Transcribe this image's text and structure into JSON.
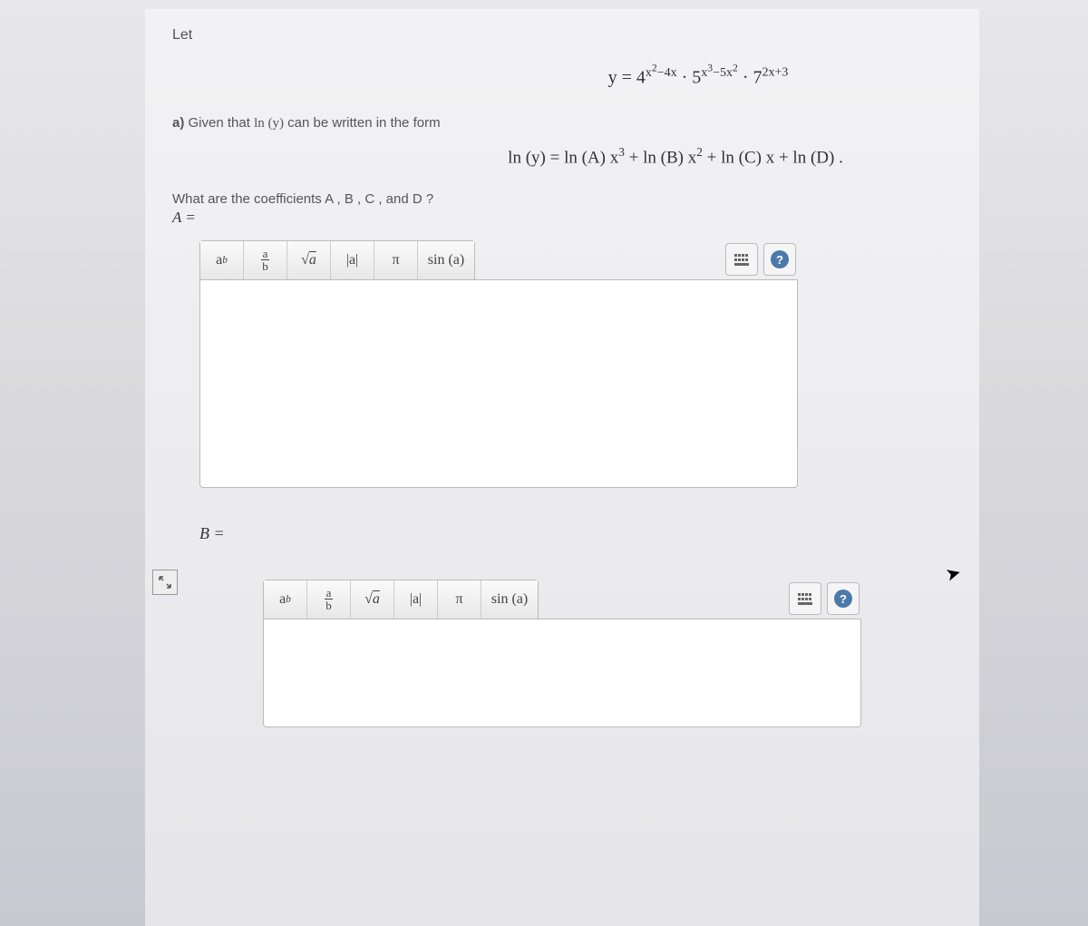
{
  "let_label": "Let",
  "equation_main_html": "y = 4<sup style='font-size:0.7em'>x<sup>2</sup>−4x</sup> · 5<sup style='font-size:0.7em'>x<sup>3</sup>−5x<sup>2</sup></sup> · 7<sup style='font-size:0.7em'>2x+3</sup>",
  "part_a_prefix": "a)",
  "part_a_text_1": " Given that ",
  "part_a_math": "ln (y)",
  "part_a_text_2": " can be written in the form",
  "ln_equation_html": "ln (y) = ln (A) x<sup style='font-size:0.7em'>3</sup> + ln (B) x<sup style='font-size:0.7em'>2</sup> + ln (C) x + ln (D) .",
  "question_text": "What are the coefficients A , B , C , and D ?",
  "coeff_A_label": "A =",
  "coeff_B_label": "B =",
  "toolbar": {
    "power_html": "a<sup style='font-size:0.7em;font-style:italic'>b</sup>",
    "frac_num": "a",
    "frac_den": "b",
    "sqrt_html": "√<span style='text-decoration:overline;font-style:italic'>a</span>",
    "abs": "|a|",
    "pi": "π",
    "sin": "sin (a)"
  },
  "help_label": "?"
}
